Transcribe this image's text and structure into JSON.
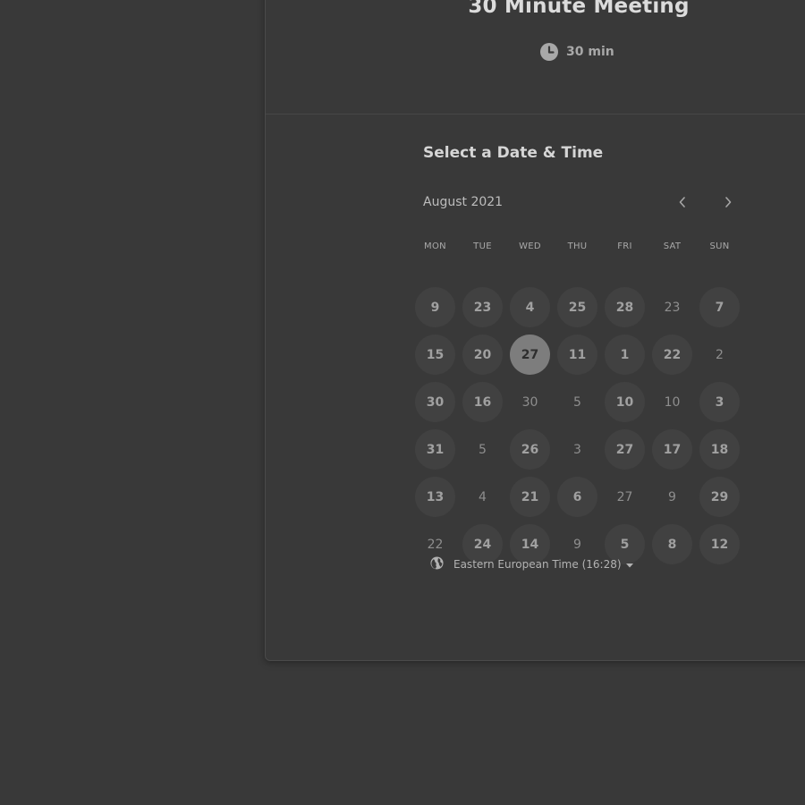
{
  "event": {
    "title": "30 Minute Meeting",
    "duration_icon": "clock-icon",
    "duration": "30 min"
  },
  "calendar": {
    "heading": "Select a Date & Time",
    "month": "August 2021",
    "prev_icon": "chevron-left-icon",
    "next_icon": "chevron-right-icon",
    "weekdays": [
      "MON",
      "TUE",
      "WED",
      "THU",
      "FRI",
      "SAT",
      "SUN"
    ],
    "weeks": [
      [
        {
          "label": "9",
          "state": "available"
        },
        {
          "label": "23",
          "state": "available"
        },
        {
          "label": "4",
          "state": "available"
        },
        {
          "label": "25",
          "state": "available"
        },
        {
          "label": "28",
          "state": "available"
        },
        {
          "label": "23",
          "state": "unavailable"
        },
        {
          "label": "7",
          "state": "available"
        }
      ],
      [
        {
          "label": "15",
          "state": "available"
        },
        {
          "label": "20",
          "state": "available"
        },
        {
          "label": "27",
          "state": "selected"
        },
        {
          "label": "11",
          "state": "available"
        },
        {
          "label": "1",
          "state": "available"
        },
        {
          "label": "22",
          "state": "available"
        },
        {
          "label": "2",
          "state": "unavailable"
        }
      ],
      [
        {
          "label": "30",
          "state": "available"
        },
        {
          "label": "16",
          "state": "available"
        },
        {
          "label": "30",
          "state": "unavailable"
        },
        {
          "label": "5",
          "state": "unavailable"
        },
        {
          "label": "10",
          "state": "available"
        },
        {
          "label": "10",
          "state": "unavailable"
        },
        {
          "label": "3",
          "state": "available"
        }
      ],
      [
        {
          "label": "31",
          "state": "available"
        },
        {
          "label": "5",
          "state": "unavailable"
        },
        {
          "label": "26",
          "state": "available"
        },
        {
          "label": "3",
          "state": "unavailable"
        },
        {
          "label": "27",
          "state": "available"
        },
        {
          "label": "17",
          "state": "available"
        },
        {
          "label": "18",
          "state": "available"
        }
      ],
      [
        {
          "label": "13",
          "state": "available"
        },
        {
          "label": "4",
          "state": "unavailable"
        },
        {
          "label": "21",
          "state": "available"
        },
        {
          "label": "6",
          "state": "available"
        },
        {
          "label": "27",
          "state": "unavailable"
        },
        {
          "label": "9",
          "state": "unavailable"
        },
        {
          "label": "29",
          "state": "available"
        }
      ],
      [
        {
          "label": "22",
          "state": "unavailable"
        },
        {
          "label": "24",
          "state": "available"
        },
        {
          "label": "14",
          "state": "available"
        },
        {
          "label": "9",
          "state": "unavailable"
        },
        {
          "label": "5",
          "state": "available"
        },
        {
          "label": "8",
          "state": "available"
        },
        {
          "label": "12",
          "state": "available"
        }
      ]
    ]
  },
  "timezone": {
    "icon": "globe-icon",
    "label": "Eastern European Time (16:28)",
    "dropdown_icon": "caret-down-icon"
  }
}
